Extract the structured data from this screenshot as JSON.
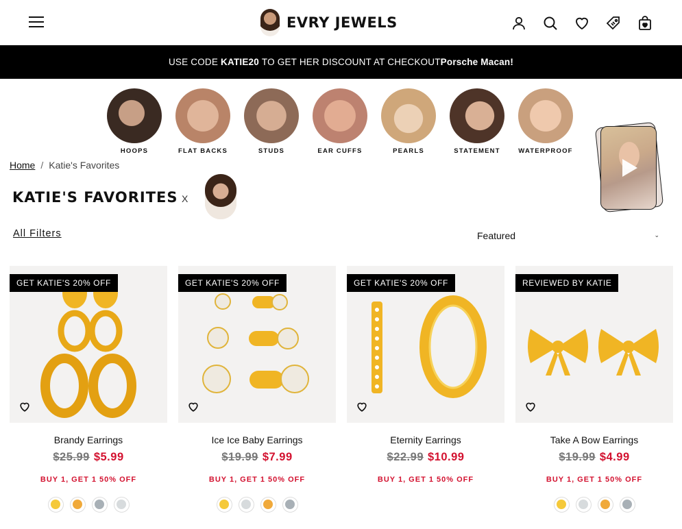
{
  "brand": {
    "name": "EVRY JEWELS"
  },
  "promo": {
    "prefix": "USE CODE ",
    "code": "KATIE20",
    "middle": " TO GET HER DISCOUNT AT CHECKOUT",
    "tail": "Porsche Macan!"
  },
  "categories": [
    {
      "label": "HOOPS",
      "tone": "#3a2a22"
    },
    {
      "label": "FLAT BACKS",
      "tone": "#c79a80"
    },
    {
      "label": "STUDS",
      "tone": "#b8947c"
    },
    {
      "label": "EAR CUFFS",
      "tone": "#c58e78"
    },
    {
      "label": "PEARLS",
      "tone": "#e3c9a6"
    },
    {
      "label": "STATEMENT",
      "tone": "#6b4a3a"
    },
    {
      "label": "WATERPROOF",
      "tone": "#d6ad8f"
    }
  ],
  "breadcrumb": {
    "home": "Home",
    "separator": "/",
    "current": "Katie's Favorites"
  },
  "title": "KATIE'S FAVORITES",
  "title_x": "X",
  "filters_label": "All Filters",
  "sort": {
    "selected": "Featured",
    "chevron": "⌄"
  },
  "colors": {
    "sale": "#d3112f",
    "gold": "#f5c93a",
    "silver": "#d7dbdd",
    "rose": "#f0a93a",
    "steel": "#a8b0b6"
  },
  "products": [
    {
      "badge": "GET KATIE'S 20% OFF",
      "name": "Brandy Earrings",
      "old_price": "$25.99",
      "price": "$5.99",
      "offer": "BUY 1, GET 1 50% OFF",
      "swatches": [
        "#f5c93a",
        "#f0a93a",
        "#a8b0b6",
        "#d7dbdd"
      ]
    },
    {
      "badge": "GET KATIE'S 20% OFF",
      "name": "Ice Ice Baby Earrings",
      "old_price": "$19.99",
      "price": "$7.99",
      "offer": "BUY 1, GET 1 50% OFF",
      "swatches": [
        "#f5c93a",
        "#d7dbdd",
        "#f0a93a",
        "#a8b0b6"
      ]
    },
    {
      "badge": "GET KATIE'S 20% OFF",
      "name": "Eternity Earrings",
      "old_price": "$22.99",
      "price": "$10.99",
      "offer": "BUY 1, GET 1 50% OFF",
      "swatches": []
    },
    {
      "badge": "REVIEWED BY KATIE",
      "name": "Take A Bow Earrings",
      "old_price": "$19.99",
      "price": "$4.99",
      "offer": "BUY 1, GET 1 50% OFF",
      "swatches": [
        "#f5c93a",
        "#d7dbdd",
        "#f0a93a",
        "#a8b0b6"
      ]
    }
  ]
}
